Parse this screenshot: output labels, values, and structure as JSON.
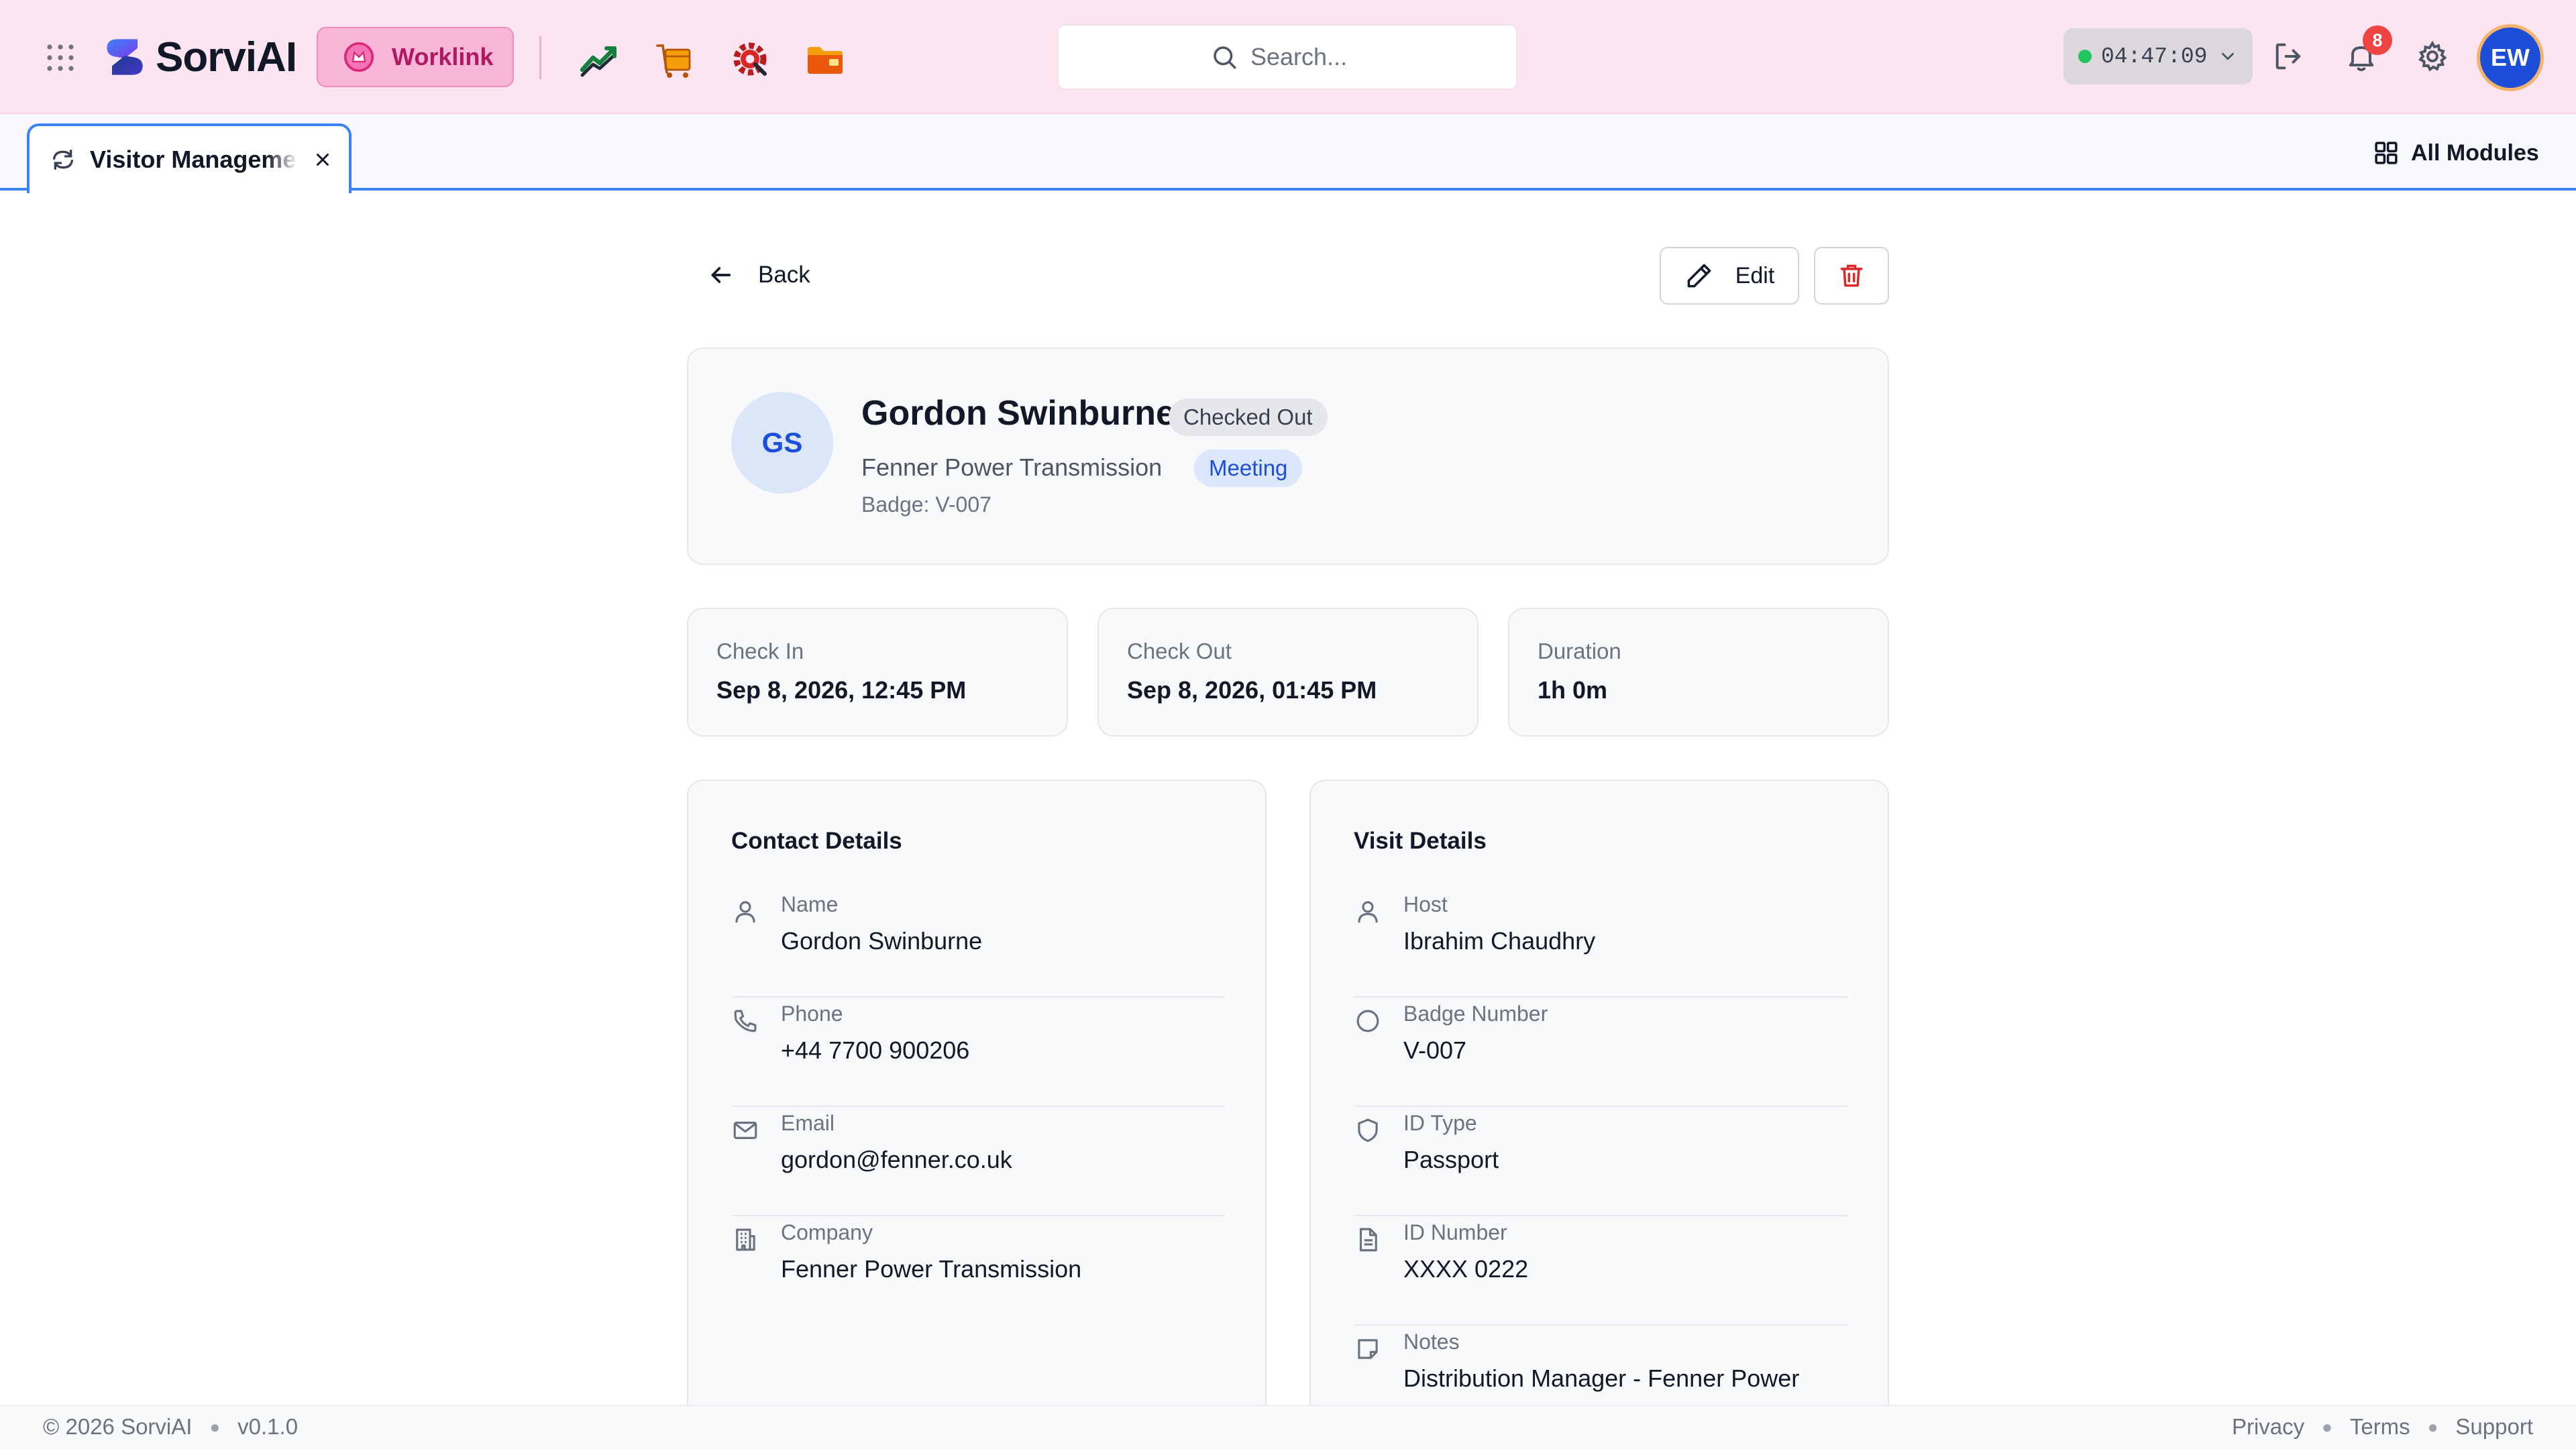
{
  "header": {
    "brand": "SorviAI",
    "workspace_button": "Worklink",
    "search_placeholder": "Search...",
    "timer": "04:47:09",
    "notification_count": "8",
    "user_initials": "EW",
    "colors": {
      "header_bg": "#fce4f1",
      "accent_blue": "#3b82f6",
      "worklink_text": "#b0195f",
      "status_online": "#22c55e",
      "badge_red": "#ef4444"
    }
  },
  "tabs": {
    "active_tab_label": "Visitor Management",
    "all_modules_label": "All Modules"
  },
  "actions": {
    "back_label": "Back",
    "edit_label": "Edit"
  },
  "visitor": {
    "initials": "GS",
    "name": "Gordon Swinburne",
    "status": "Checked Out",
    "company": "Fenner Power Transmission",
    "purpose": "Meeting",
    "badge_line": "Badge: V-007"
  },
  "stats": [
    {
      "label": "Check In",
      "value": "Sep 8, 2026, 12:45 PM"
    },
    {
      "label": "Check Out",
      "value": "Sep 8, 2026, 01:45 PM"
    },
    {
      "label": "Duration",
      "value": "1h 0m"
    }
  ],
  "contact_details": {
    "title": "Contact Details",
    "rows": [
      {
        "label": "Name",
        "value": "Gordon Swinburne",
        "icon": "user-icon"
      },
      {
        "label": "Phone",
        "value": "+44 7700 900206",
        "icon": "phone-icon"
      },
      {
        "label": "Email",
        "value": "gordon@fenner.co.uk",
        "icon": "mail-icon"
      },
      {
        "label": "Company",
        "value": "Fenner Power Transmission",
        "icon": "building-icon"
      }
    ]
  },
  "visit_details": {
    "title": "Visit Details",
    "rows": [
      {
        "label": "Host",
        "value": "Ibrahim Chaudhry",
        "icon": "user-icon"
      },
      {
        "label": "Badge Number",
        "value": "V-007",
        "icon": "circle-icon"
      },
      {
        "label": "ID Type",
        "value": "Passport",
        "icon": "shield-icon"
      },
      {
        "label": "ID Number",
        "value": "XXXX 0222",
        "icon": "document-icon"
      },
      {
        "label": "Notes",
        "value": "Distribution Manager - Fenner Power",
        "icon": "note-icon"
      }
    ]
  },
  "footer": {
    "copyright": "© 2026 SorviAI",
    "version": "v0.1.0",
    "links": [
      "Privacy",
      "Terms",
      "Support"
    ]
  }
}
